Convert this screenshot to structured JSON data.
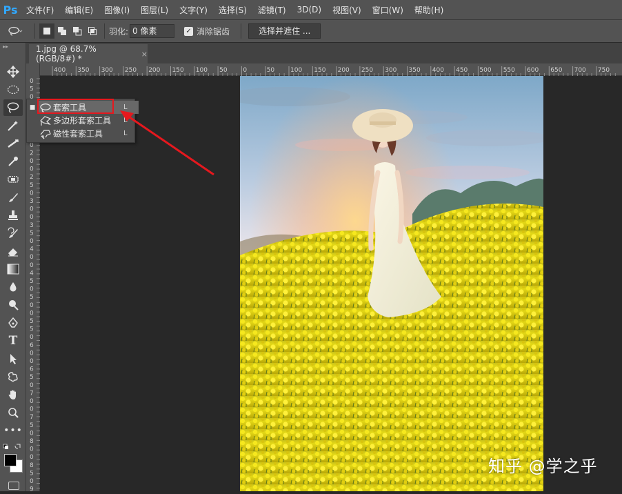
{
  "app": {
    "logo": "Ps"
  },
  "menu": [
    "文件(F)",
    "编辑(E)",
    "图像(I)",
    "图层(L)",
    "文字(Y)",
    "选择(S)",
    "滤镜(T)",
    "3D(D)",
    "视图(V)",
    "窗口(W)",
    "帮助(H)"
  ],
  "options": {
    "feather_label": "羽化:",
    "feather_value": "0 像素",
    "antialias_label": "消除锯齿",
    "antialias_checked": true,
    "select_mask_button": "选择并遮住 ..."
  },
  "document": {
    "tab_title": "1.jpg @ 68.7%(RGB/8#) *",
    "close": "×"
  },
  "ruler_h_labels": [
    "400",
    "350",
    "300",
    "250",
    "200",
    "150",
    "100",
    "50",
    "0",
    "50",
    "100",
    "150",
    "200",
    "250",
    "300",
    "350",
    "400",
    "450",
    "500",
    "550",
    "600",
    "650",
    "700",
    "750"
  ],
  "ruler_v_labels": [
    "0",
    "5",
    "0",
    "1",
    "0",
    "0",
    "1",
    "5",
    "0",
    "2",
    "0",
    "0",
    "2",
    "5",
    "0",
    "3",
    "0",
    "0",
    "3",
    "5",
    "0",
    "4",
    "0",
    "0",
    "4",
    "5",
    "0",
    "5",
    "0",
    "0",
    "5",
    "5",
    "0",
    "6",
    "0",
    "0",
    "6",
    "5",
    "0",
    "7",
    "0",
    "0",
    "7",
    "5",
    "0",
    "8",
    "0",
    "0",
    "8",
    "5",
    "0",
    "9",
    "0"
  ],
  "flyout": {
    "items": [
      {
        "label": "套索工具",
        "key": "L",
        "active": true
      },
      {
        "label": "多边形套索工具",
        "key": "L",
        "active": false
      },
      {
        "label": "磁性套索工具",
        "key": "L",
        "active": false
      }
    ]
  },
  "tools": [
    "move-icon",
    "marquee-icon",
    "lasso-icon",
    "magic-wand-icon",
    "crop-icon",
    "eyedropper-icon",
    "healing-brush-icon",
    "brush-icon",
    "clone-stamp-icon",
    "history-brush-icon",
    "eraser-icon",
    "gradient-icon",
    "blur-icon",
    "dodge-icon",
    "pen-icon",
    "type-icon",
    "path-selection-icon",
    "custom-shape-icon",
    "hand-icon",
    "zoom-icon",
    "more-icon"
  ],
  "type_tool_label": "T",
  "watermark": "知乎 @学之乎",
  "colors": {
    "accent_red": "#e5181e",
    "ps_blue": "#31a8ff",
    "panel": "#535353",
    "canvas": "#282828"
  }
}
